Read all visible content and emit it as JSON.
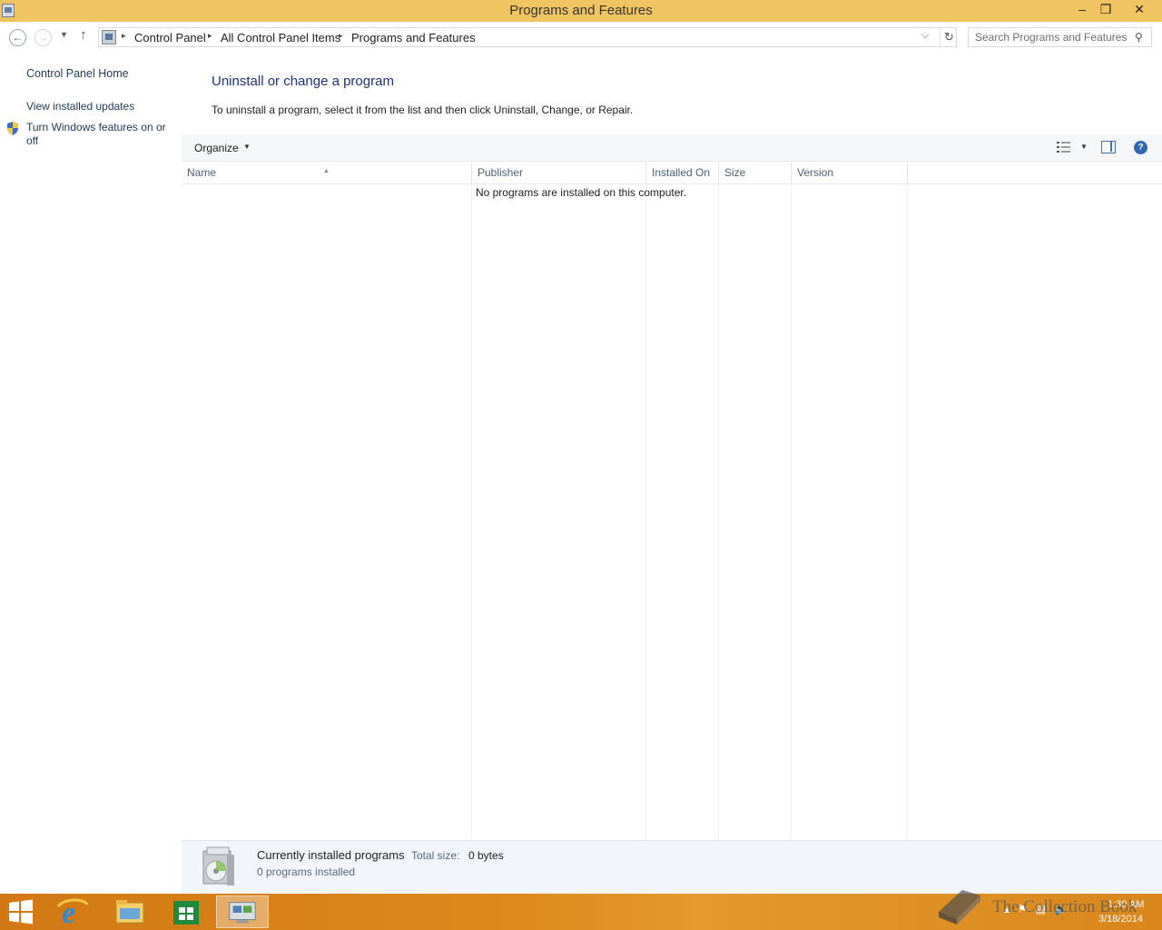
{
  "window": {
    "title": "Programs and Features",
    "controls": {
      "minimize": "–",
      "maximize": "❐",
      "close": "✕"
    }
  },
  "nav": {
    "back_glyph": "←",
    "forward_glyph": "→",
    "recent_glyph": "▼",
    "up_glyph": "↑",
    "breadcrumbs": [
      "Control Panel",
      "All Control Panel Items",
      "Programs and Features"
    ],
    "separator": "▸",
    "dropdown_glyph": "⌵",
    "refresh_glyph": "↻",
    "search_placeholder": "Search Programs and Features",
    "search_glyph": "⚲"
  },
  "sidebar": {
    "home": "Control Panel Home",
    "updates": "View installed updates",
    "features": "Turn Windows features on or off"
  },
  "main": {
    "title": "Uninstall or change a program",
    "description": "To uninstall a program, select it from the list and then click Uninstall, Change, or Repair."
  },
  "commandbar": {
    "organize": "Organize",
    "organize_arrow": "▼",
    "view_arrow": "▼",
    "help": "?"
  },
  "list": {
    "columns": [
      "Name",
      "Publisher",
      "Installed On",
      "Size",
      "Version"
    ],
    "sort_glyph": "▲",
    "empty_message": "No programs are installed on this computer."
  },
  "details": {
    "title": "Currently installed programs",
    "total_size_label": "Total size:",
    "total_size": "0 bytes",
    "count": "0 programs installed"
  },
  "taskbar": {
    "time": "1:30 AM",
    "date": "3/18/2014",
    "tray_glyphs": "▴⚑▤🔈",
    "watermark": "The Collection Book"
  },
  "colors": {
    "titlebar": "#f1c462",
    "link": "#1e395b",
    "heading": "#1e3287",
    "taskbar": "#dd8a1c"
  }
}
